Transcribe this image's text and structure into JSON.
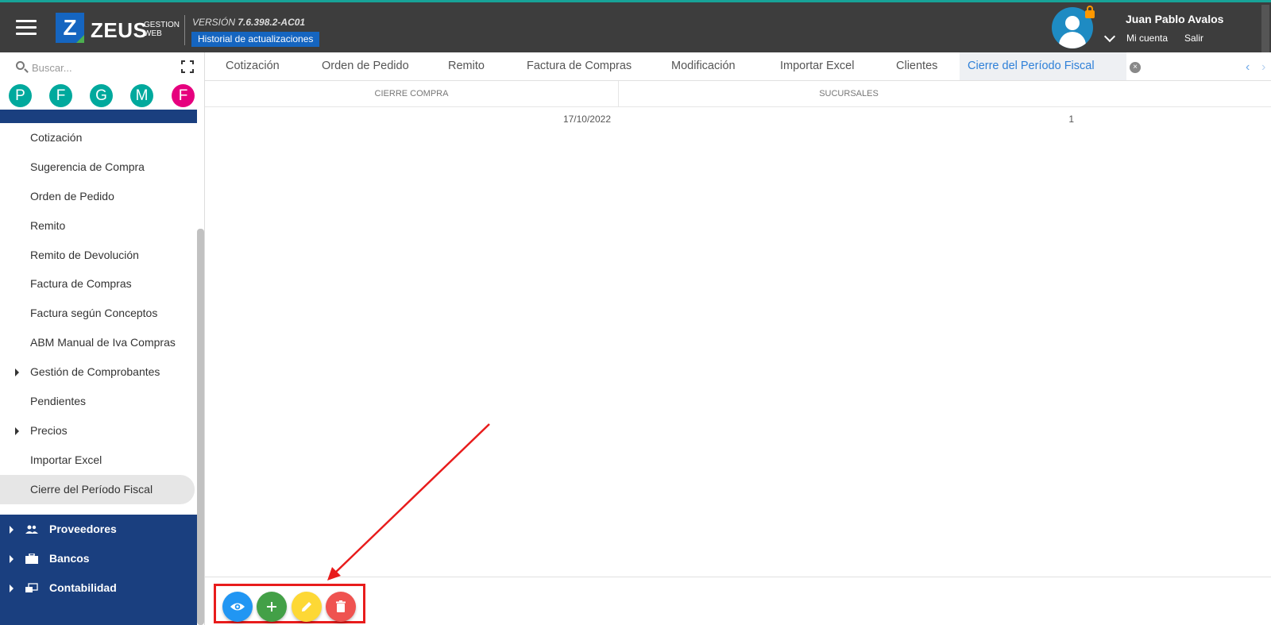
{
  "header": {
    "logo_letter": "Z",
    "logo_name": "ZEUS",
    "logo_sub_1": "GESTION",
    "logo_sub_2": "WEB",
    "version_label": "VERSIÓN",
    "version_number": "7.6.398.2-AC01",
    "history_button": "Historial de actualizaciones",
    "user_name": "Juan Pablo Avalos",
    "account_link": "Mi cuenta",
    "logout_link": "Salir"
  },
  "sidebar": {
    "search_placeholder": "Buscar...",
    "favorites": [
      {
        "letter": "P",
        "color": "#00a99d"
      },
      {
        "letter": "F",
        "color": "#00a99d"
      },
      {
        "letter": "G",
        "color": "#00a99d"
      },
      {
        "letter": "M",
        "color": "#00a99d"
      },
      {
        "letter": "F",
        "color": "#e6007e"
      }
    ],
    "submenu": [
      {
        "label": "Cotización"
      },
      {
        "label": "Sugerencia de Compra"
      },
      {
        "label": "Orden de Pedido"
      },
      {
        "label": "Remito"
      },
      {
        "label": "Remito de Devolución"
      },
      {
        "label": "Factura de Compras"
      },
      {
        "label": "Factura según Conceptos"
      },
      {
        "label": "ABM Manual de Iva Compras"
      },
      {
        "label": "Gestión de Comprobantes"
      },
      {
        "label": "Pendientes"
      },
      {
        "label": "Precios"
      },
      {
        "label": "Importar Excel"
      },
      {
        "label": "Cierre del Período Fiscal"
      }
    ],
    "mainmenu": [
      {
        "label": "Proveedores",
        "icon": "people-icon"
      },
      {
        "label": "Bancos",
        "icon": "briefcase-icon"
      },
      {
        "label": "Contabilidad",
        "icon": "ledger-icon"
      }
    ]
  },
  "tabs": [
    {
      "label": "Cotización"
    },
    {
      "label": "Orden de Pedido"
    },
    {
      "label": "Remito"
    },
    {
      "label": "Factura de Compras"
    },
    {
      "label": "Modificación"
    },
    {
      "label": "Importar Excel"
    },
    {
      "label": "Clientes"
    },
    {
      "label": "Cierre del Período Fiscal"
    }
  ],
  "grid": {
    "columns": [
      "CIERRE COMPRA",
      "SUCURSALES"
    ],
    "rows": [
      {
        "cierre_compra": "17/10/2022",
        "sucursales": "1"
      }
    ]
  },
  "actions": {
    "view_color": "#2196f3",
    "add_color": "#43a047",
    "edit_color": "#fdd835",
    "delete_color": "#ef5350",
    "highlight_color": "#e81c1c"
  },
  "colors": {
    "topbar": "#3d3d3d",
    "brand_blue": "#1565c0",
    "menu_blue": "#1a3f7f",
    "active_tab_text": "#2f80d8"
  }
}
